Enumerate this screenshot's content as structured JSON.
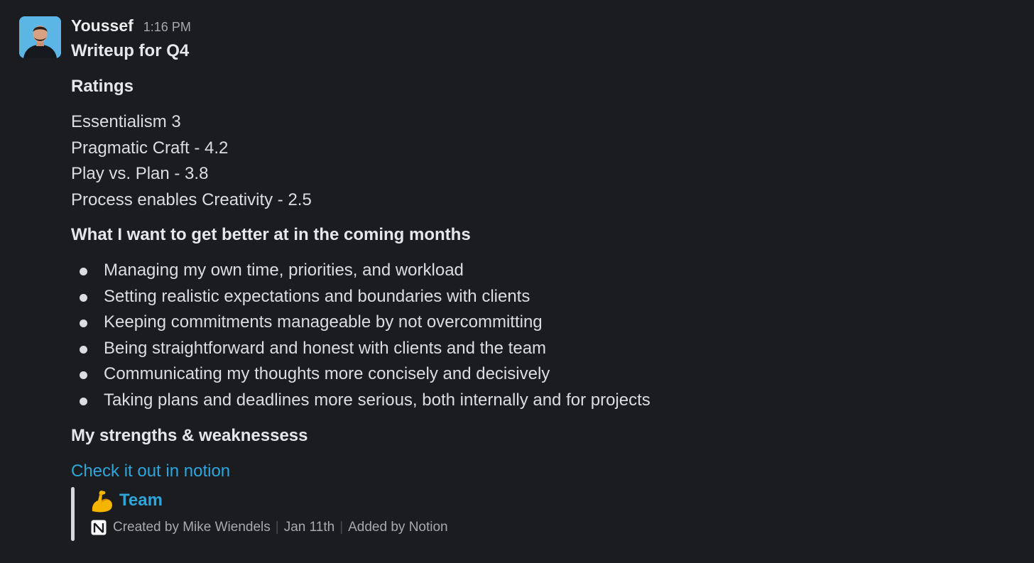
{
  "message": {
    "author": "Youssef",
    "timestamp": "1:16 PM",
    "title": "Writeup for Q4",
    "ratings_heading": "Ratings",
    "ratings": [
      "Essentialism 3",
      "Pragmatic Craft - 4.2",
      "Play vs. Plan - 3.8",
      "Process enables Creativity - 2.5"
    ],
    "improve_heading": "What I want to get better at in the coming months",
    "improve_items": [
      "Managing my own time, priorities, and workload",
      "Setting realistic expectations and boundaries with clients",
      "Keeping commitments manageable by not overcommitting",
      "Being straightforward and honest with clients and the team",
      "Communicating my thoughts more concisely and decisively",
      "Taking plans and deadlines more serious, both internally and for projects"
    ],
    "strengths_heading": "My strengths & weaknessess",
    "link_text": "Check it out in notion",
    "unfurl": {
      "title": "Team",
      "created_by": "Created by Mike Wiendels",
      "date": "Jan 11th",
      "added_by": "Added by Notion",
      "separator": "|"
    }
  },
  "colors": {
    "background": "#1b1c20",
    "text": "#dcdde0",
    "muted": "#a8a9ad",
    "link": "#2ea6dc"
  },
  "icons": {
    "avatar": "avatar-photo",
    "emoji": "flexed-biceps-icon",
    "app": "notion-icon"
  }
}
